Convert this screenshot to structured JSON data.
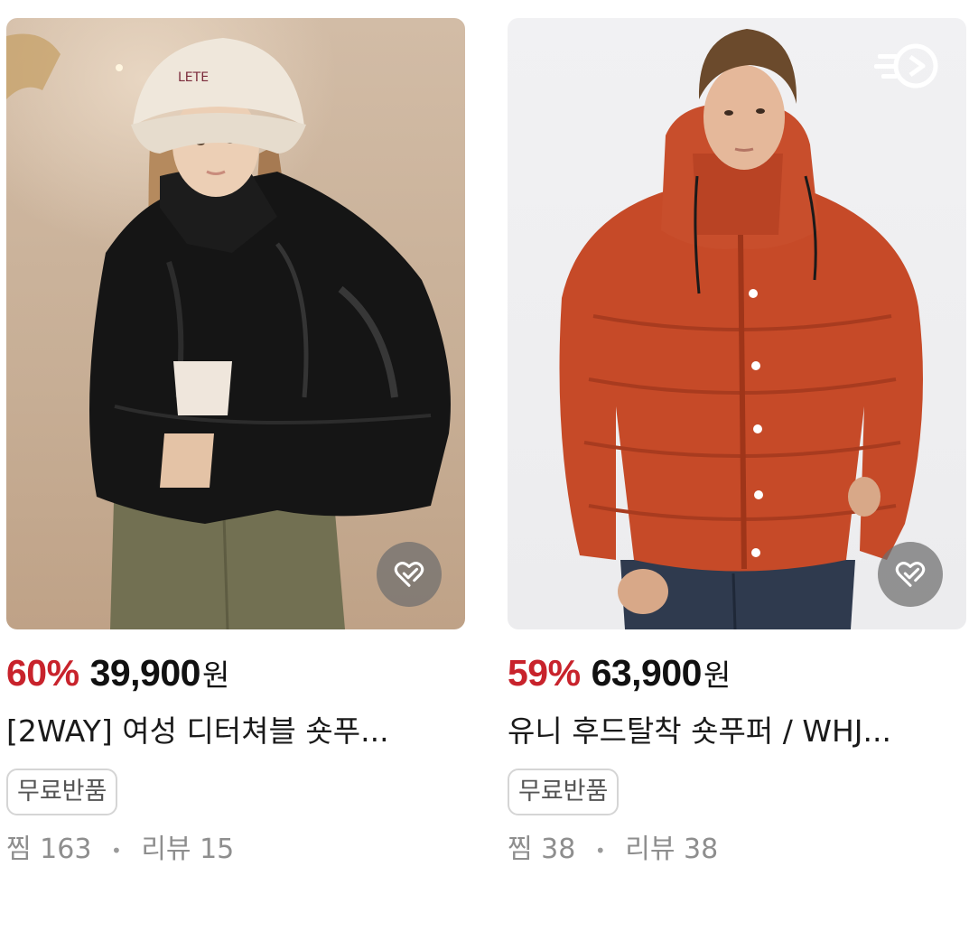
{
  "products": [
    {
      "discount": "60%",
      "price": "39,900",
      "currency": "원",
      "title": "[2WAY] 여성 디터쳐블 숏푸...",
      "badge": "무료반품",
      "likes_label": "찜",
      "likes": "163",
      "reviews_label": "리뷰",
      "reviews": "15",
      "jacket_color": "#161616",
      "image_desc_icon": "black-padded-jacket-photo"
    },
    {
      "discount": "59%",
      "price": "63,900",
      "currency": "원",
      "title": "유니 후드탈착 숏푸퍼 / WHJ...",
      "badge": "무료반품",
      "likes_label": "찜",
      "likes": "38",
      "reviews_label": "리뷰",
      "reviews": "38",
      "jacket_color": "#c94a2a",
      "image_desc_icon": "orange-hooded-puffer-photo"
    }
  ],
  "colors": {
    "discount": "#c8232c",
    "price": "#111111",
    "muted": "#8e8e8e"
  },
  "icons": {
    "wishlist": "heart-check-icon",
    "brand": "delivery-brand-logo"
  }
}
